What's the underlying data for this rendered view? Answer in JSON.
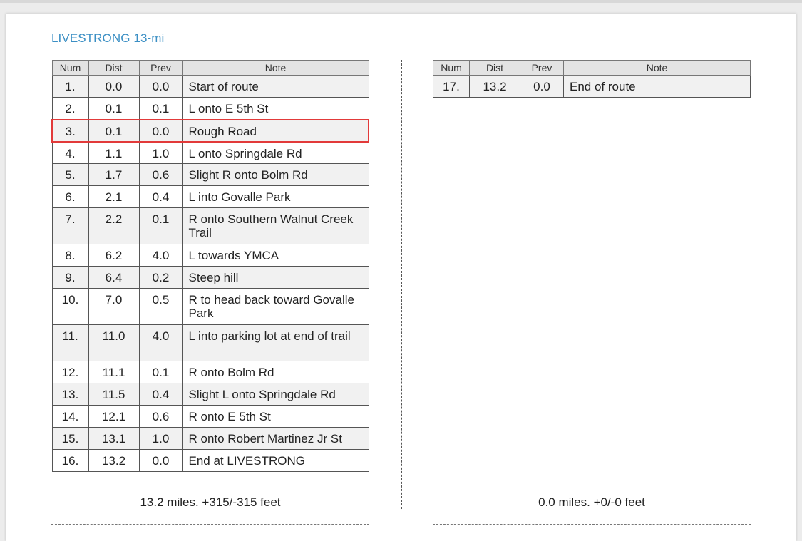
{
  "title": "LIVESTRONG 13-mi",
  "columns": {
    "num": "Num",
    "dist": "Dist",
    "prev": "Prev",
    "note": "Note"
  },
  "left_rows": [
    {
      "num": "1.",
      "dist": "0.0",
      "prev": "0.0",
      "note": "Start of route"
    },
    {
      "num": "2.",
      "dist": "0.1",
      "prev": "0.1",
      "note": "L onto E 5th St"
    },
    {
      "num": "3.",
      "dist": "0.1",
      "prev": "0.0",
      "note": "Rough Road",
      "selected": true
    },
    {
      "num": "4.",
      "dist": "1.1",
      "prev": "1.0",
      "note": "L onto Springdale Rd"
    },
    {
      "num": "5.",
      "dist": "1.7",
      "prev": "0.6",
      "note": "Slight R onto Bolm Rd"
    },
    {
      "num": "6.",
      "dist": "2.1",
      "prev": "0.4",
      "note": "L into Govalle Park"
    },
    {
      "num": "7.",
      "dist": "2.2",
      "prev": "0.1",
      "note": "R onto Southern Walnut Creek Trail",
      "tall": true
    },
    {
      "num": "8.",
      "dist": "6.2",
      "prev": "4.0",
      "note": "L towards YMCA"
    },
    {
      "num": "9.",
      "dist": "6.4",
      "prev": "0.2",
      "note": "Steep hill"
    },
    {
      "num": "10.",
      "dist": "7.0",
      "prev": "0.5",
      "note": "R to head back toward Govalle Park",
      "tall": true
    },
    {
      "num": "11.",
      "dist": "11.0",
      "prev": "4.0",
      "note": "L into parking lot at end of trail",
      "tall": true
    },
    {
      "num": "12.",
      "dist": "11.1",
      "prev": "0.1",
      "note": "R onto Bolm Rd"
    },
    {
      "num": "13.",
      "dist": "11.5",
      "prev": "0.4",
      "note": "Slight L onto Springdale Rd"
    },
    {
      "num": "14.",
      "dist": "12.1",
      "prev": "0.6",
      "note": "R onto E 5th St"
    },
    {
      "num": "15.",
      "dist": "13.1",
      "prev": "1.0",
      "note": "R onto Robert Martinez Jr St"
    },
    {
      "num": "16.",
      "dist": "13.2",
      "prev": "0.0",
      "note": "End at LIVESTRONG"
    }
  ],
  "right_rows": [
    {
      "num": "17.",
      "dist": "13.2",
      "prev": "0.0",
      "note": "End of route"
    }
  ],
  "left_summary": "13.2 miles.  +315/-315 feet",
  "right_summary": "0.0 miles.  +0/-0 feet",
  "colors": {
    "title": "#3b8fc4",
    "selected_border": "#e23a3a",
    "header_bg": "#e3e3e3",
    "alt_row_bg": "#f1f1f1"
  }
}
